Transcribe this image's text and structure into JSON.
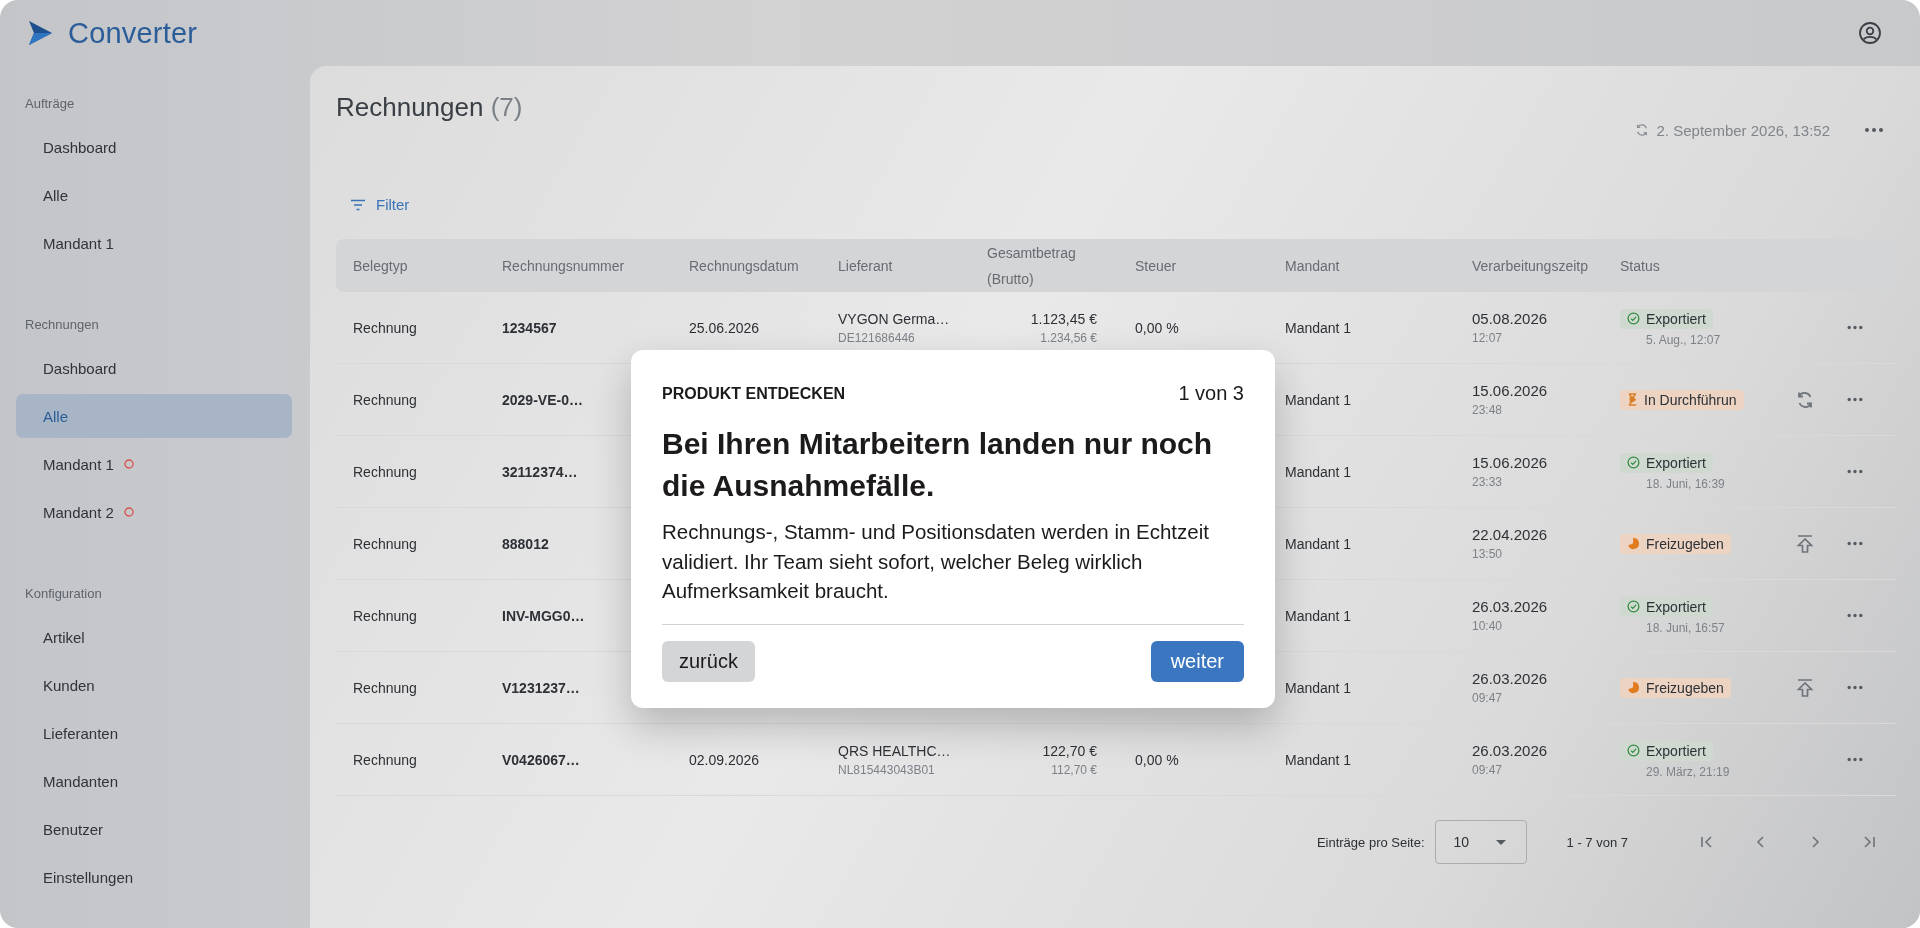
{
  "app": {
    "title": "Converter"
  },
  "sidebar": {
    "sections": [
      {
        "title": "Aufträge",
        "items": [
          {
            "label": "Dashboard",
            "selected": false,
            "alert": false
          },
          {
            "label": "Alle",
            "selected": false,
            "alert": false
          },
          {
            "label": "Mandant 1",
            "selected": false,
            "alert": false
          }
        ]
      },
      {
        "title": "Rechnungen",
        "items": [
          {
            "label": "Dashboard",
            "selected": false,
            "alert": false
          },
          {
            "label": "Alle",
            "selected": true,
            "alert": false
          },
          {
            "label": "Mandant 1",
            "selected": false,
            "alert": true
          },
          {
            "label": "Mandant 2",
            "selected": false,
            "alert": true
          }
        ]
      },
      {
        "title": "Konfiguration",
        "items": [
          {
            "label": "Artikel",
            "selected": false,
            "alert": false
          },
          {
            "label": "Kunden",
            "selected": false,
            "alert": false
          },
          {
            "label": "Lieferanten",
            "selected": false,
            "alert": false
          },
          {
            "label": "Mandanten",
            "selected": false,
            "alert": false
          },
          {
            "label": "Benutzer",
            "selected": false,
            "alert": false
          },
          {
            "label": "Einstellungen",
            "selected": false,
            "alert": false
          }
        ]
      }
    ]
  },
  "page": {
    "title": "Rechnungen",
    "count": "(7)",
    "last_sync": "2. September 2026, 13:52",
    "filter_label": "Filter"
  },
  "table": {
    "columns": [
      "Belegtyp",
      "Rechnungsnummer",
      "Rechnungsdatum",
      "Lieferant",
      "Gesamtbetrag (Brutto)",
      "Steuer",
      "Mandant",
      "Verarbeitungszeitp",
      "Status"
    ],
    "rows": [
      {
        "type": "Rechnung",
        "number": "1234567",
        "date": "25.06.2026",
        "supplier": "VYGON Germa…",
        "supplier_id": "DE121686446",
        "gross": "1.123,45 €",
        "net": "1.234,56 €",
        "tax": "0,00 %",
        "client": "Mandant 1",
        "processed_date": "05.08.2026",
        "processed_time": "12:07",
        "status": {
          "kind": "exported",
          "label": "Exportiert",
          "detail": "5. Aug., 12:07"
        }
      },
      {
        "type": "Rechnung",
        "number": "2029-VE-0…",
        "client": "Mandant 1",
        "processed_date": "15.06.2026",
        "processed_time": "23:48",
        "status": {
          "kind": "running",
          "label": "In Durchführun"
        },
        "action": {
          "kind": "retry"
        }
      },
      {
        "type": "Rechnung",
        "number": "32112374…",
        "client": "Mandant 1",
        "processed_date": "15.06.2026",
        "processed_time": "23:33",
        "status": {
          "kind": "exported",
          "label": "Exportiert",
          "detail": "18. Juni, 16:39"
        }
      },
      {
        "type": "Rechnung",
        "number": "888012",
        "client": "Mandant 1",
        "processed_date": "22.04.2026",
        "processed_time": "13:50",
        "status": {
          "kind": "release",
          "label": "Freizugeben"
        },
        "action": {
          "kind": "release"
        }
      },
      {
        "type": "Rechnung",
        "number": "INV-MGG0…",
        "client": "Mandant 1",
        "processed_date": "26.03.2026",
        "processed_time": "10:40",
        "status": {
          "kind": "exported",
          "label": "Exportiert",
          "detail": "18. Juni, 16:57"
        }
      },
      {
        "type": "Rechnung",
        "number": "V1231237…",
        "client": "Mandant 1",
        "processed_date": "26.03.2026",
        "processed_time": "09:47",
        "status": {
          "kind": "release",
          "label": "Freizugeben"
        },
        "action": {
          "kind": "release"
        }
      },
      {
        "type": "Rechnung",
        "number": "V0426067…",
        "date": "02.09.2026",
        "supplier": "QRS HEALTHC…",
        "supplier_id": "NL815443043B01",
        "gross": "122,70 €",
        "net": "112,70 €",
        "tax": "0,00 %",
        "client": "Mandant 1",
        "processed_date": "26.03.2026",
        "processed_time": "09:47",
        "status": {
          "kind": "exported",
          "label": "Exportiert",
          "detail": "29. März, 21:19"
        }
      }
    ]
  },
  "pagination": {
    "per_page_label": "Einträge pro Seite:",
    "per_page": "10",
    "range": "1 - 7 von 7"
  },
  "tour": {
    "eyebrow": "PRODUKT ENTDECKEN",
    "step": "1 von 3",
    "heading": "Bei Ihren Mitarbeitern landen nur noch die Ausnahmefälle.",
    "body": "Rechnungs-, Stamm- und Positionsdaten werden in Echtzeit validiert. Ihr Team sieht sofort, welcher Beleg wirklich Aufmerksamkeit braucht.",
    "back": "zurück",
    "next": "weiter"
  }
}
